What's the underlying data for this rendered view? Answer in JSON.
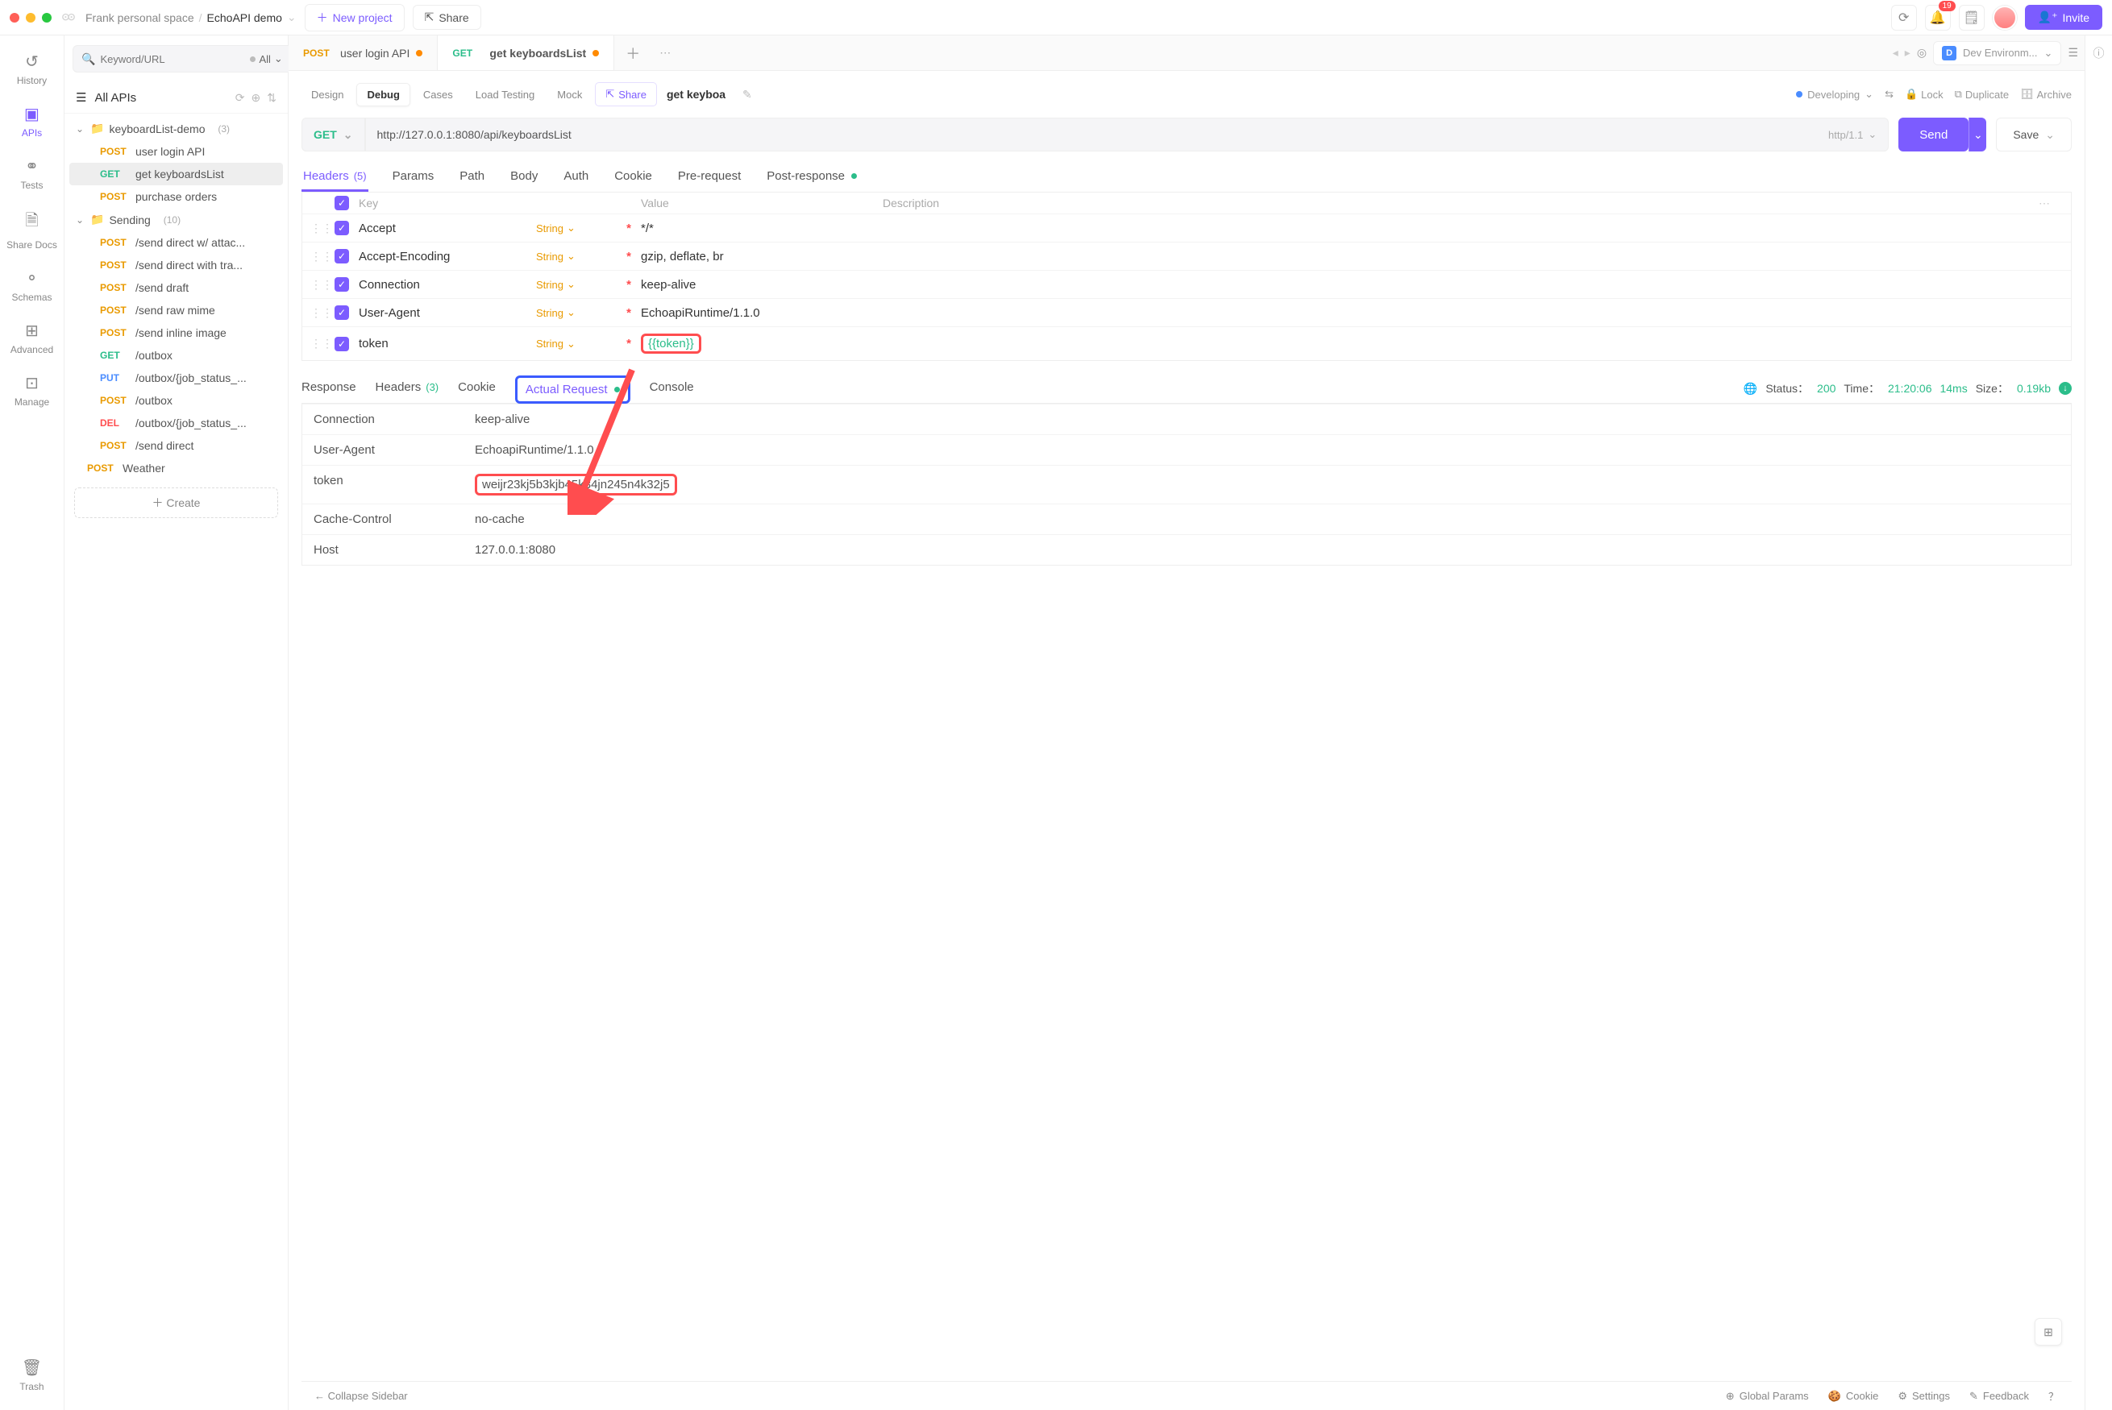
{
  "titlebar": {
    "workspace": "Frank personal space",
    "project": "EchoAPI demo",
    "new_project": "New project",
    "share": "Share",
    "notif_count": "19",
    "invite": "Invite"
  },
  "rail": [
    {
      "label": "History",
      "icon": "↺"
    },
    {
      "label": "APIs",
      "icon": "▣",
      "active": true
    },
    {
      "label": "Tests",
      "icon": "⚭"
    },
    {
      "label": "Share Docs",
      "icon": "🗎"
    },
    {
      "label": "Schemas",
      "icon": "⚬"
    },
    {
      "label": "Advanced",
      "icon": "⊞"
    },
    {
      "label": "Manage",
      "icon": "⊡"
    }
  ],
  "trash": "Trash",
  "sidebar": {
    "search_placeholder": "Keyword/URL",
    "filter_label": "All",
    "all_apis": "All APIs",
    "folders": [
      {
        "name": "keyboardList-demo",
        "count": "(3)",
        "items": [
          {
            "method": "POST",
            "name": "user login API"
          },
          {
            "method": "GET",
            "name": "get keyboardsList",
            "active": true
          },
          {
            "method": "POST",
            "name": "purchase orders"
          }
        ]
      },
      {
        "name": "Sending",
        "count": "(10)",
        "items": [
          {
            "method": "POST",
            "name": "/send direct w/ attac..."
          },
          {
            "method": "POST",
            "name": "/send direct with tra..."
          },
          {
            "method": "POST",
            "name": "/send draft"
          },
          {
            "method": "POST",
            "name": "/send raw mime"
          },
          {
            "method": "POST",
            "name": "/send inline image"
          },
          {
            "method": "GET",
            "name": "/outbox"
          },
          {
            "method": "PUT",
            "name": "/outbox/{job_status_..."
          },
          {
            "method": "POST",
            "name": "/outbox"
          },
          {
            "method": "DEL",
            "name": "/outbox/{job_status_..."
          },
          {
            "method": "POST",
            "name": "/send direct"
          }
        ]
      }
    ],
    "loose": [
      {
        "method": "POST",
        "name": "Weather"
      }
    ],
    "create": "Create"
  },
  "tabs": [
    {
      "method": "POST",
      "label": "user login API",
      "dirty": true
    },
    {
      "method": "GET",
      "label": "get keyboardsList",
      "dirty": true,
      "active": true
    }
  ],
  "env": {
    "label": "Dev Environm..."
  },
  "view_tabs": {
    "items": [
      "Design",
      "Debug",
      "Cases",
      "Load Testing",
      "Mock"
    ],
    "active": "Debug",
    "share": "Share",
    "api_name": "get keyboa",
    "status": "Developing",
    "actions": {
      "lock": "Lock",
      "duplicate": "Duplicate",
      "archive": "Archive"
    }
  },
  "request": {
    "method": "GET",
    "url": "http://127.0.0.1:8080/api/keyboardsList",
    "http": "http/1.1",
    "send": "Send",
    "save": "Save"
  },
  "sub_tabs": {
    "items": [
      {
        "label": "Headers",
        "count": "(5)",
        "active": true
      },
      {
        "label": "Params"
      },
      {
        "label": "Path"
      },
      {
        "label": "Body"
      },
      {
        "label": "Auth"
      },
      {
        "label": "Cookie"
      },
      {
        "label": "Pre-request"
      },
      {
        "label": "Post-response",
        "dot": true
      }
    ]
  },
  "headers": {
    "cols": {
      "key": "Key",
      "value": "Value",
      "desc": "Description"
    },
    "rows": [
      {
        "key": "Accept",
        "type": "String",
        "value": "*/*"
      },
      {
        "key": "Accept-Encoding",
        "type": "String",
        "value": "gzip, deflate, br"
      },
      {
        "key": "Connection",
        "type": "String",
        "value": "keep-alive"
      },
      {
        "key": "User-Agent",
        "type": "String",
        "value": "EchoapiRuntime/1.1.0"
      },
      {
        "key": "token",
        "type": "String",
        "value": "{{token}}",
        "highlight": true
      }
    ]
  },
  "resp_tabs": {
    "items": [
      {
        "label": "Response"
      },
      {
        "label": "Headers",
        "count": "(3)"
      },
      {
        "label": "Cookie"
      },
      {
        "label": "Actual Request",
        "active": true,
        "dot": true
      },
      {
        "label": "Console"
      }
    ],
    "meta": {
      "status_k": "Status：",
      "status_v": "200",
      "time_k": "Time：",
      "time_v": "21:20:06",
      "time_ms": "14ms",
      "size_k": "Size：",
      "size_v": "0.19kb"
    }
  },
  "actual_request": [
    {
      "k": "Connection",
      "v": "keep-alive"
    },
    {
      "k": "User-Agent",
      "v": "EchoapiRuntime/1.1.0"
    },
    {
      "k": "token",
      "v": "weijr23kj5b3kjb45k34jn245n4k32j5",
      "boxed": true
    },
    {
      "k": "Cache-Control",
      "v": "no-cache"
    },
    {
      "k": "Host",
      "v": "127.0.0.1:8080"
    }
  ],
  "footer": {
    "collapse": "Collapse Sidebar",
    "items": [
      "Global Params",
      "Cookie",
      "Settings",
      "Feedback"
    ]
  }
}
